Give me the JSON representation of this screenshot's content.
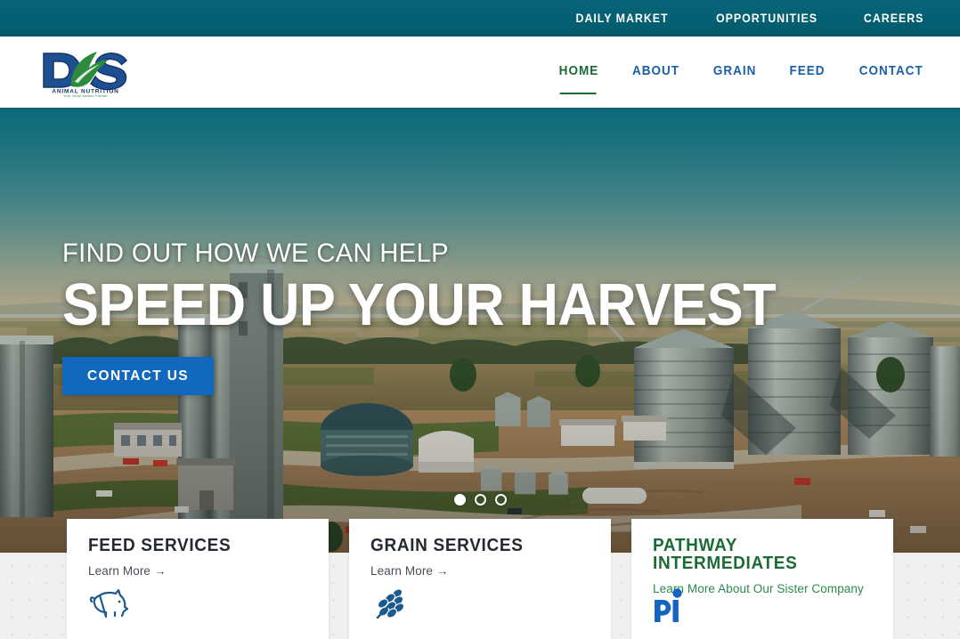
{
  "topbar": {
    "links": [
      {
        "label": "DAILY MARKET",
        "name": "daily-market"
      },
      {
        "label": "OPPORTUNITIES",
        "name": "opportunities"
      },
      {
        "label": "CAREERS",
        "name": "careers"
      }
    ],
    "background_color": "#055f72"
  },
  "header": {
    "logo": {
      "letters": "D S",
      "wordmark": "ANIMAL NUTRITION",
      "tagline": "Your Value Adding Partner",
      "blue": "#1d4f91",
      "green": "#2e8b3d"
    },
    "nav": [
      {
        "label": "HOME",
        "active": true
      },
      {
        "label": "ABOUT",
        "active": false
      },
      {
        "label": "GRAIN",
        "active": false
      },
      {
        "label": "FEED",
        "active": false
      },
      {
        "label": "CONTACT",
        "active": false
      }
    ],
    "active_color": "#186a32",
    "link_color": "#1a5fa8"
  },
  "hero": {
    "kicker": "FIND OUT HOW WE CAN HELP",
    "title": "SPEED UP YOUR HARVEST",
    "cta_label": "CONTACT US",
    "cta_color": "#1268bd",
    "slide_count": 3,
    "active_slide": 1,
    "image_description": "Aerial photo of a grain elevator facility with concrete silos and steel grain bins surrounded by farmland"
  },
  "cards": [
    {
      "title": "FEED SERVICES",
      "link": "Learn More →",
      "icon": "pig-icon",
      "accent": "#1b5a8f",
      "style": "dark"
    },
    {
      "title": "GRAIN SERVICES",
      "link": "Learn More →",
      "icon": "wheat-icon",
      "accent": "#1b5a8f",
      "style": "dark"
    },
    {
      "title": "PATHWAY INTERMEDIATES",
      "link": "Learn More About Our Sister Company →",
      "icon": "pathway-logo-icon",
      "accent": "#1565c0",
      "style": "green"
    }
  ]
}
